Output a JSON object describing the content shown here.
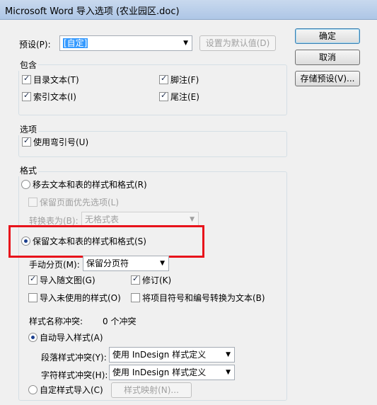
{
  "window": {
    "title": "Microsoft Word 导入选项 (农业园区.doc)"
  },
  "preset": {
    "label": "预设(P):",
    "value": "[自定]",
    "set_default_button": "设置为默认值(D)"
  },
  "side_buttons": {
    "ok": "确定",
    "cancel": "取消",
    "save_preset": "存储预设(V)..."
  },
  "include": {
    "title": "包含",
    "items": [
      {
        "label": "目录文本(T)",
        "checked": true
      },
      {
        "label": "索引文本(I)",
        "checked": true
      },
      {
        "label": "脚注(F)",
        "checked": true
      },
      {
        "label": "尾注(E)",
        "checked": true
      }
    ]
  },
  "options": {
    "title": "选项",
    "curly_quotes": {
      "label": "使用弯引号(U)",
      "checked": true
    }
  },
  "format": {
    "title": "格式",
    "remove_styles": {
      "label": "移去文本和表的样式和格式(R)",
      "selected": false
    },
    "preserve_local_overrides": {
      "label": "保留页面优先选项(L)",
      "checked": false
    },
    "convert_tables": {
      "label": "转换表为(B):",
      "value": "无格式表"
    },
    "preserve_styles": {
      "label": "保留文本和表的样式和格式(S)",
      "selected": true
    },
    "manual_page_breaks": {
      "label": "手动分页(M):",
      "value": "保留分页符"
    },
    "import_inline_graphics": {
      "label": "导入随文图(G)",
      "checked": true
    },
    "track_changes": {
      "label": "修订(K)",
      "checked": true
    },
    "import_unused_styles": {
      "label": "导入未使用的样式(O)",
      "checked": false
    },
    "convert_bullets": {
      "label": "将项目符号和编号转换为文本(B)",
      "checked": false
    },
    "style_conflicts": {
      "label": "样式名称冲突:",
      "value": "0 个冲突"
    },
    "auto_import": {
      "label": "自动导入样式(A)",
      "selected": true
    },
    "paragraph_conflicts": {
      "label": "段落样式冲突(Y):",
      "value": "使用 InDesign 样式定义"
    },
    "character_conflicts": {
      "label": "字符样式冲突(H):",
      "value": "使用 InDesign 样式定义"
    },
    "customize_import": {
      "label": "自定样式导入(C)",
      "selected": false
    },
    "style_mapping_button": "样式映射(N)..."
  },
  "colors": {
    "highlight": "#e8131b",
    "selection": "#3399ff"
  }
}
